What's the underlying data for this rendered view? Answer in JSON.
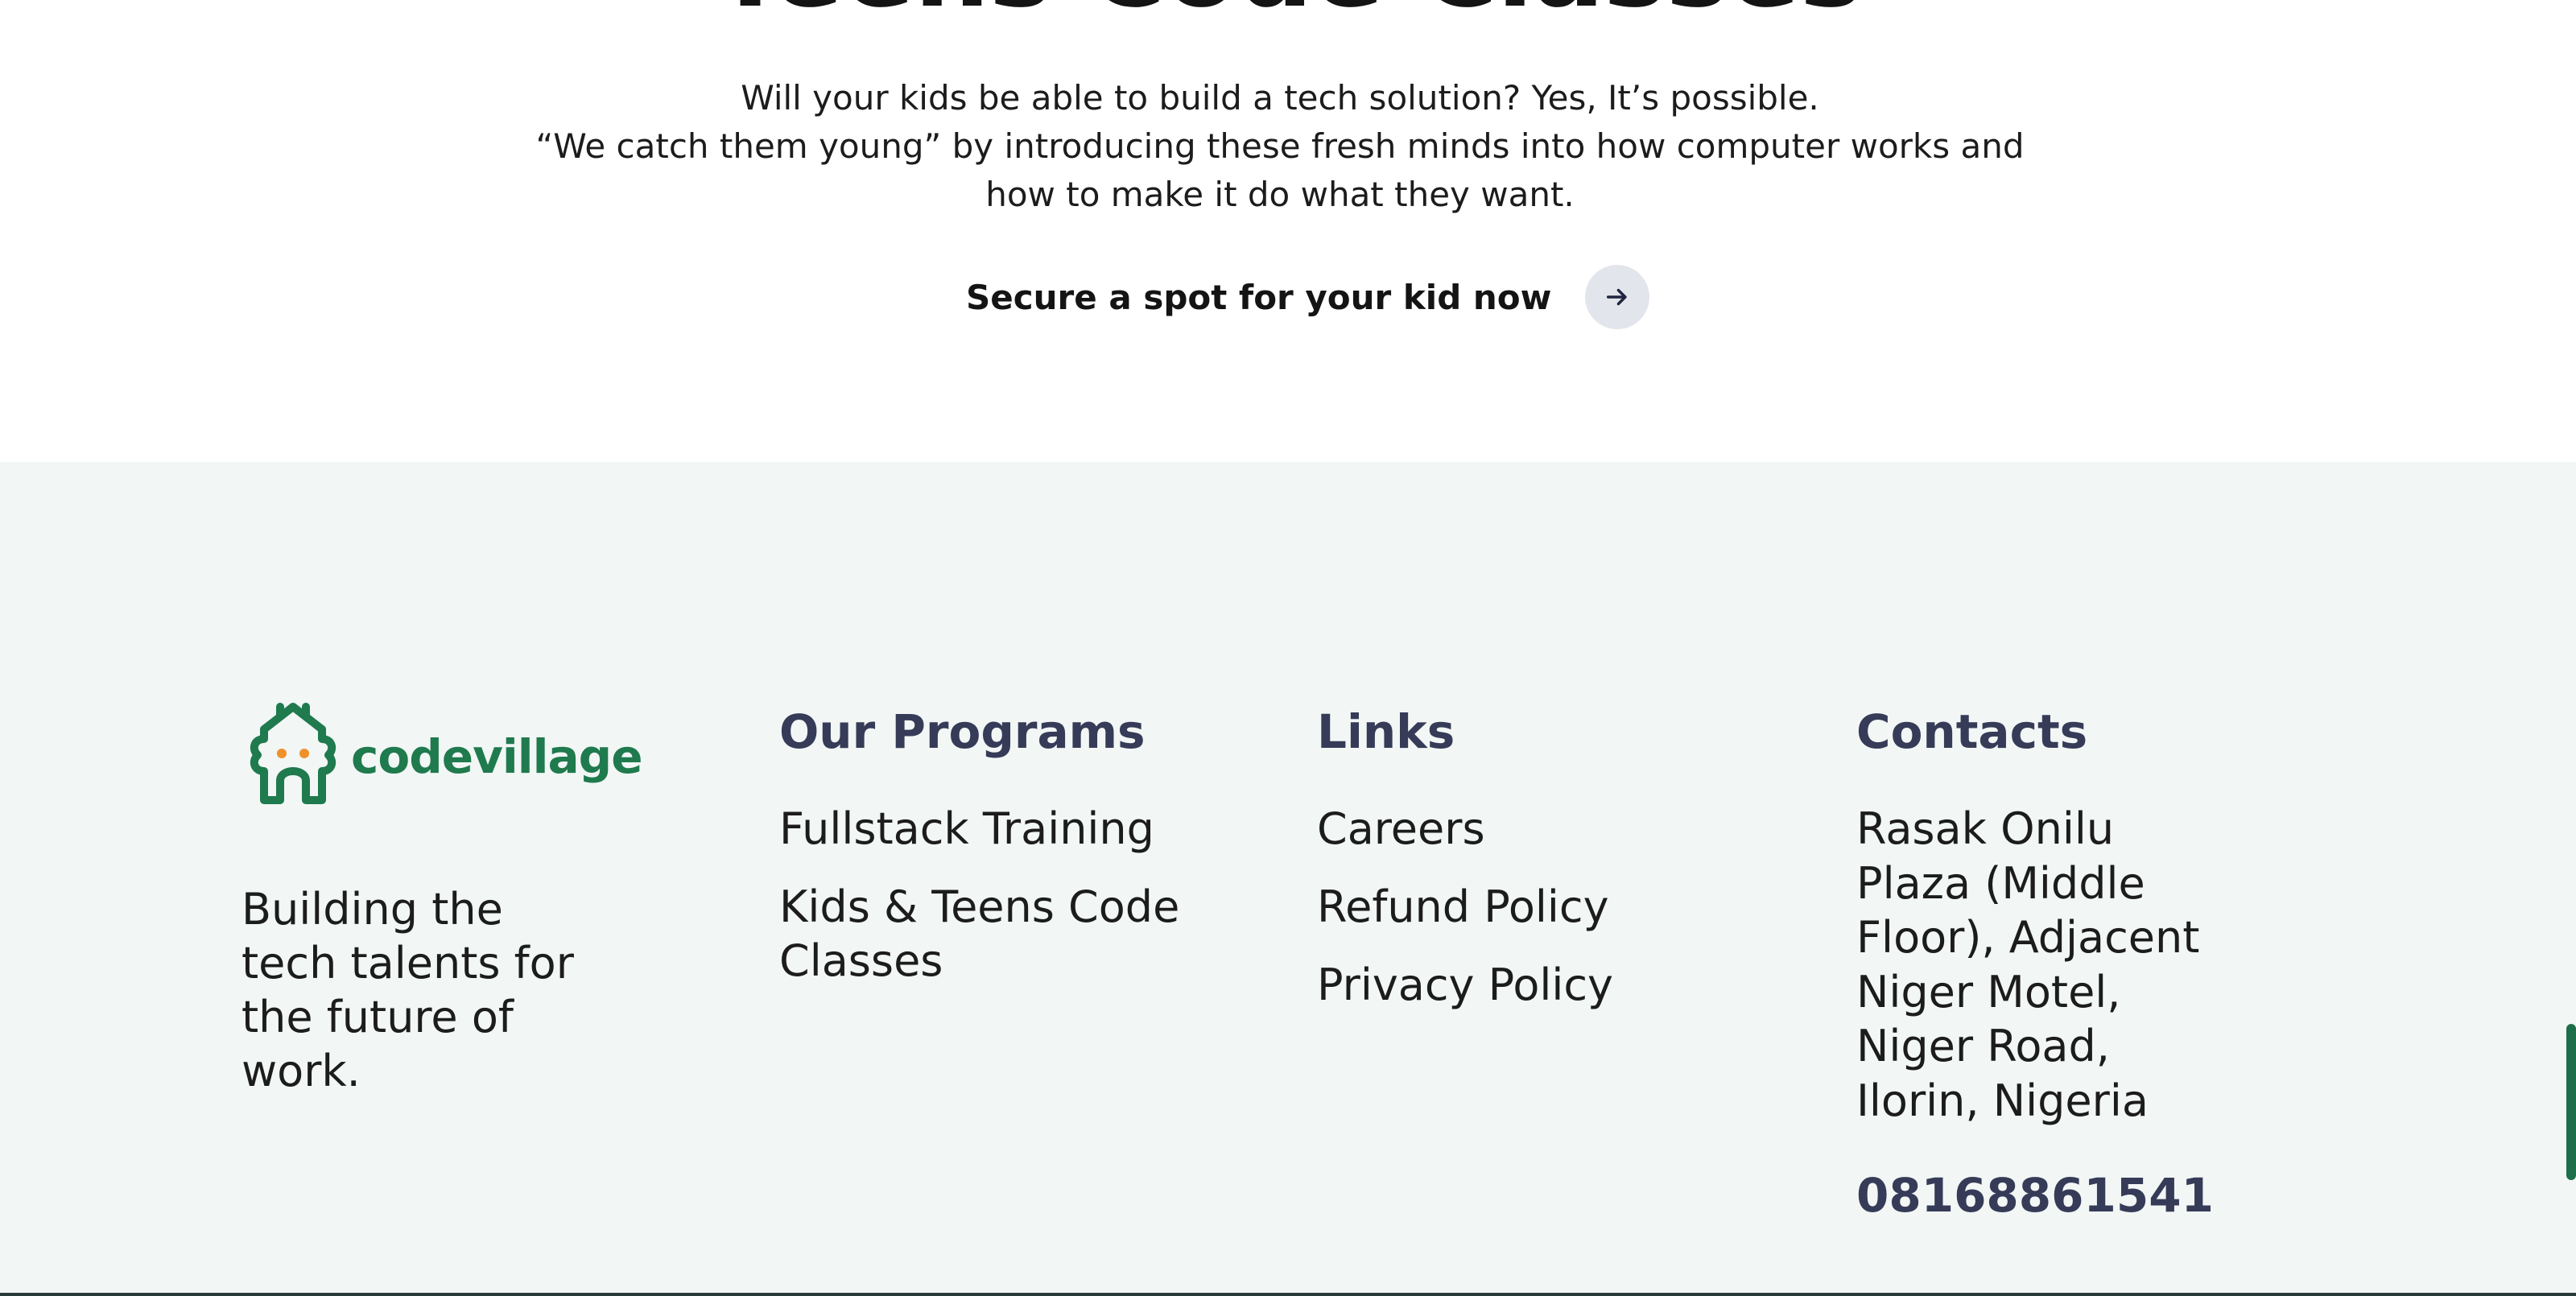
{
  "hero": {
    "title": "Teens Code Classes",
    "description_lines": [
      "Will your kids be able to build a tech solution? Yes, It’s possible.",
      "“We catch them young” by introducing these fresh minds into how computer works and how to make it do what they want."
    ],
    "cta_label": "Secure a spot for your kid now",
    "cta_icon": "arrow-right-icon"
  },
  "footer": {
    "brand": {
      "logo_text": "codevillage",
      "logo_icon": "house-mascot-icon",
      "tagline": "Building the tech talents for the future of work."
    },
    "programs": {
      "heading": "Our Programs",
      "items": [
        "Fullstack Training",
        "Kids & Teens Code Classes"
      ]
    },
    "links": {
      "heading": "Links",
      "items": [
        "Careers",
        "Refund Policy",
        "Privacy Policy"
      ]
    },
    "contacts": {
      "heading": "Contacts",
      "address": "Rasak Onilu Plaza (Middle Floor), Adjacent Niger Motel, Niger Road, Ilorin, Nigeria",
      "phone": "08168861541"
    }
  },
  "colors": {
    "brand_green": "#1f7a4e",
    "heading_navy": "#363b58",
    "footer_bg": "#f2f6f5",
    "accent_orange": "#f0902a"
  }
}
